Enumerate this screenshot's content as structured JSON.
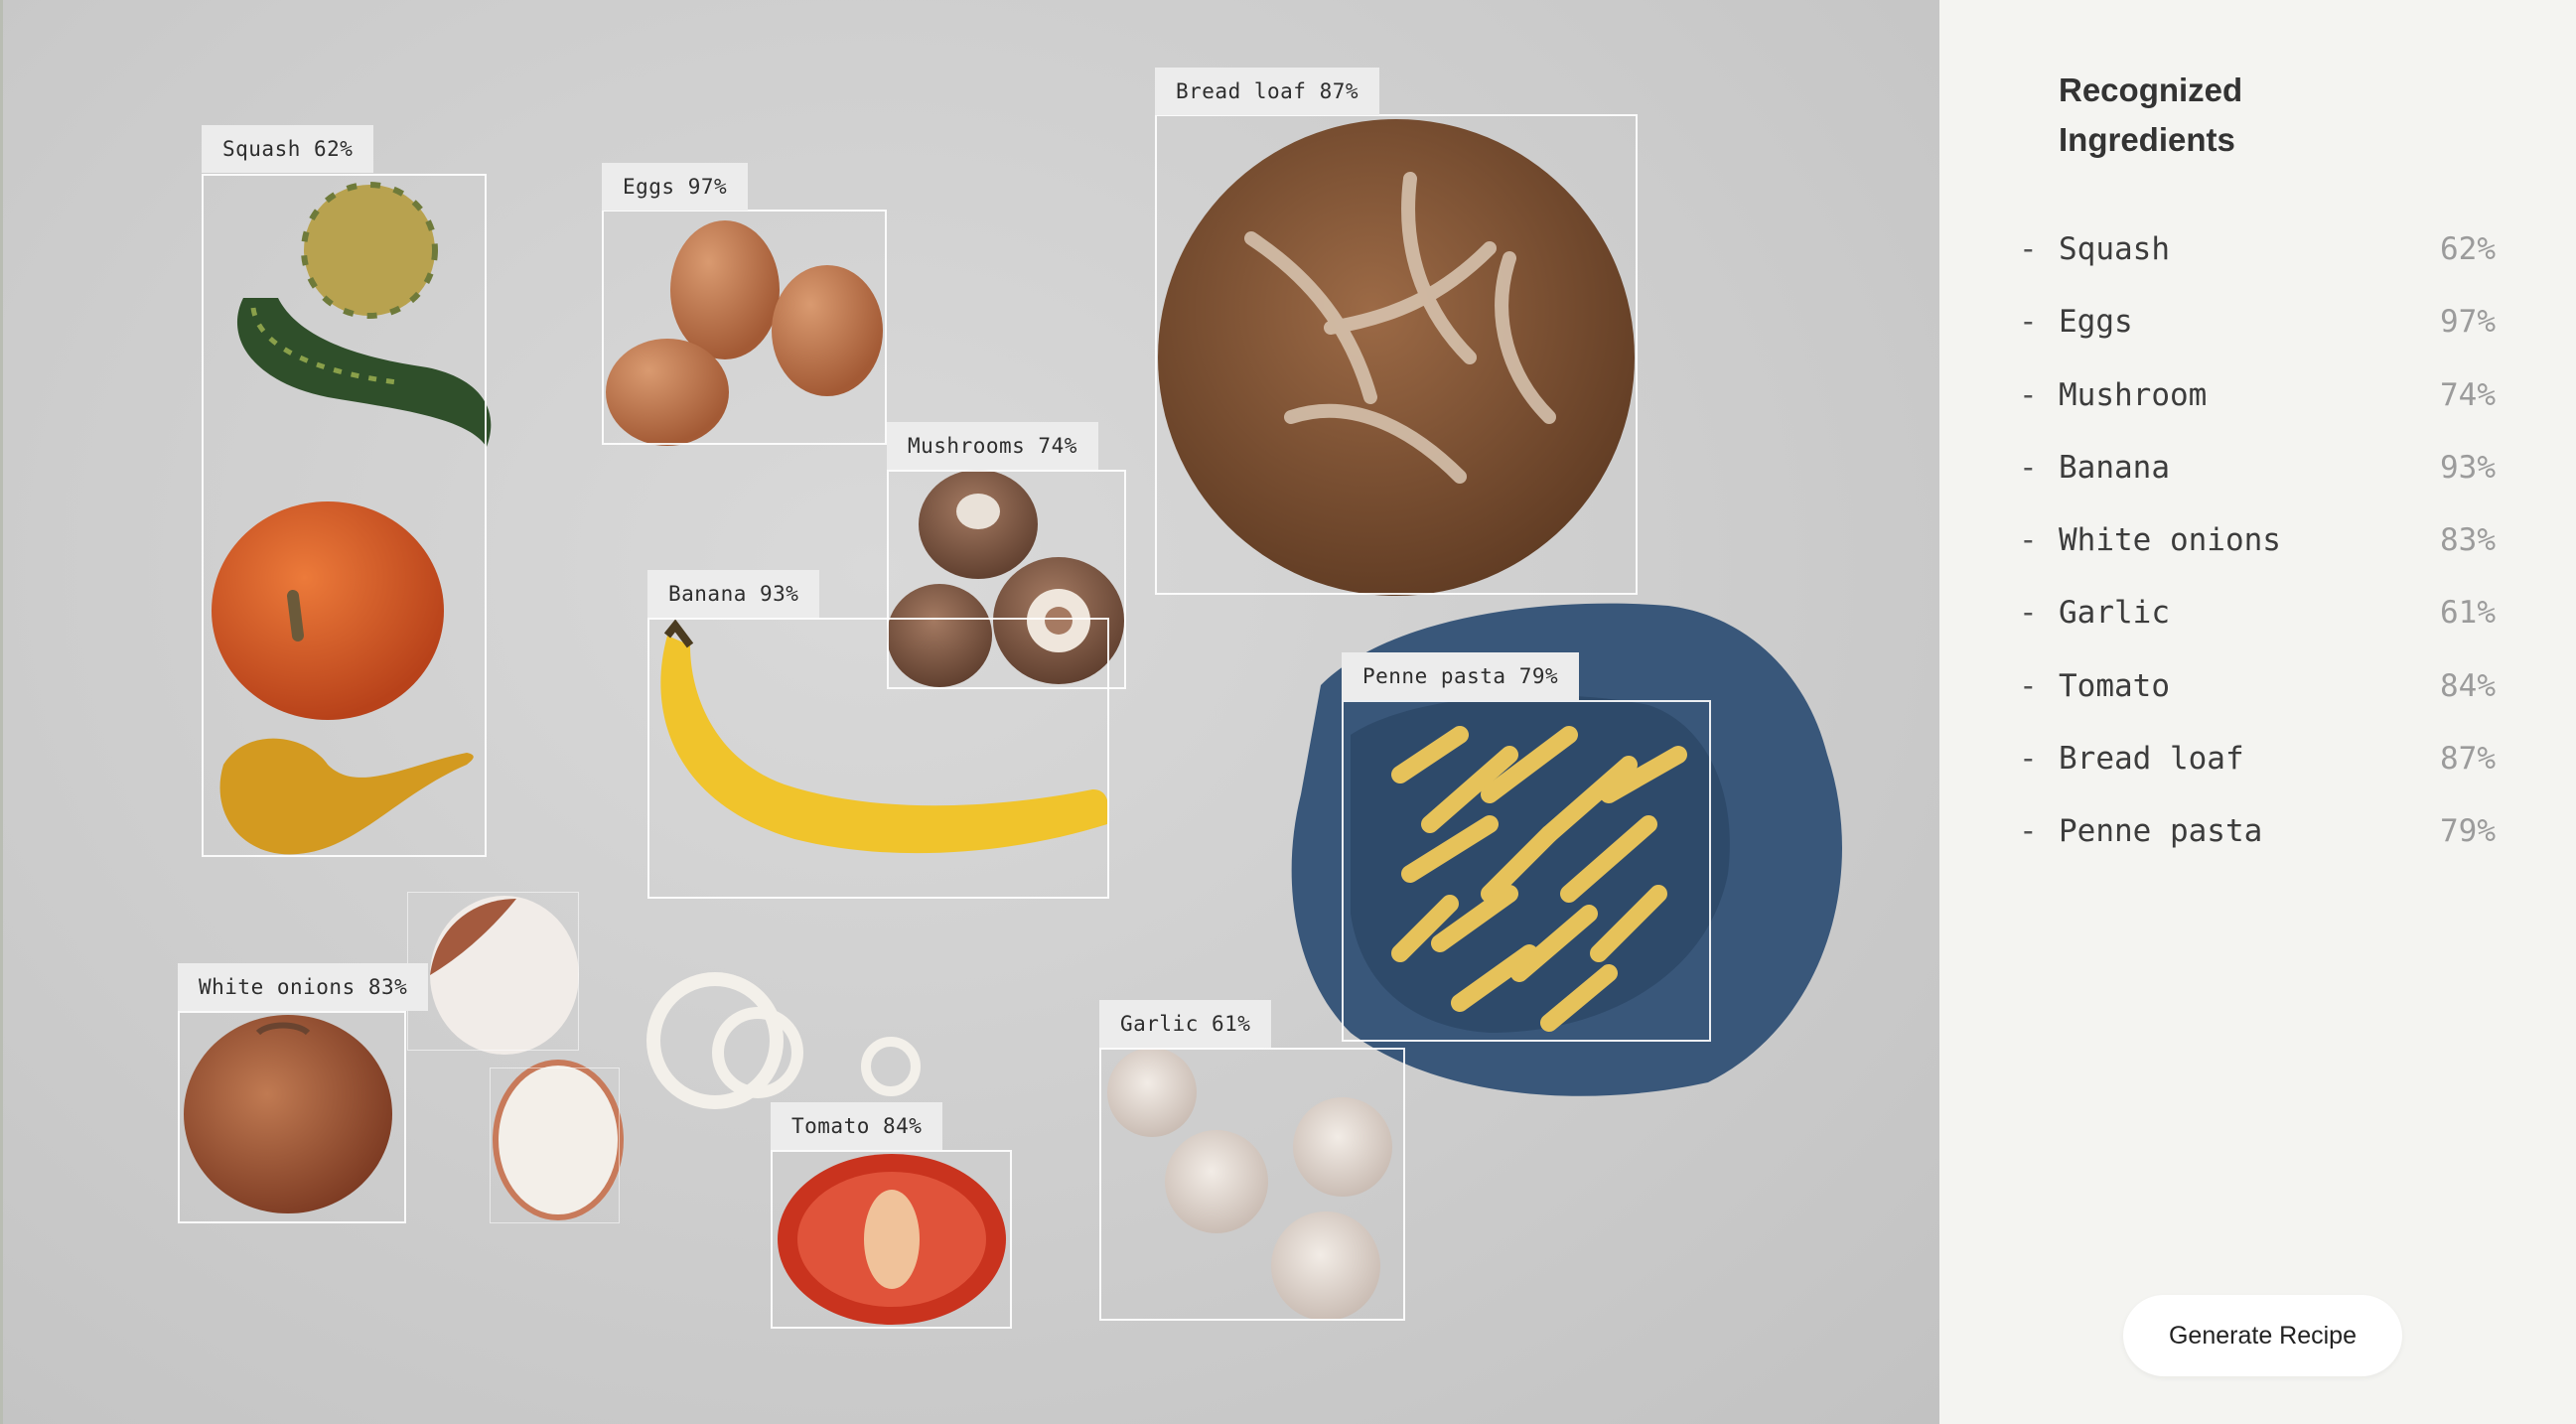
{
  "detections": [
    {
      "label": "Squash 62%"
    },
    {
      "label": "Eggs 97%"
    },
    {
      "label": "Bread loaf 87%"
    },
    {
      "label": "Mushrooms 74%"
    },
    {
      "label": "Banana 93%"
    },
    {
      "label": "Penne pasta 79%"
    },
    {
      "label": "White onions 83%"
    },
    {
      "label": "Garlic 61%"
    },
    {
      "label": "Tomato 84%"
    }
  ],
  "panel": {
    "title": "Recognized Ingredients",
    "dash": "-",
    "items": [
      {
        "name": "Squash",
        "confidence": "62%"
      },
      {
        "name": "Eggs",
        "confidence": "97%"
      },
      {
        "name": "Mushroom",
        "confidence": "74%"
      },
      {
        "name": "Banana",
        "confidence": "93%"
      },
      {
        "name": "White onions",
        "confidence": "83%"
      },
      {
        "name": "Garlic",
        "confidence": "61%"
      },
      {
        "name": "Tomato",
        "confidence": "84%"
      },
      {
        "name": "Bread loaf",
        "confidence": "87%"
      },
      {
        "name": "Penne pasta",
        "confidence": "79%"
      }
    ],
    "button_label": "Generate Recipe"
  }
}
